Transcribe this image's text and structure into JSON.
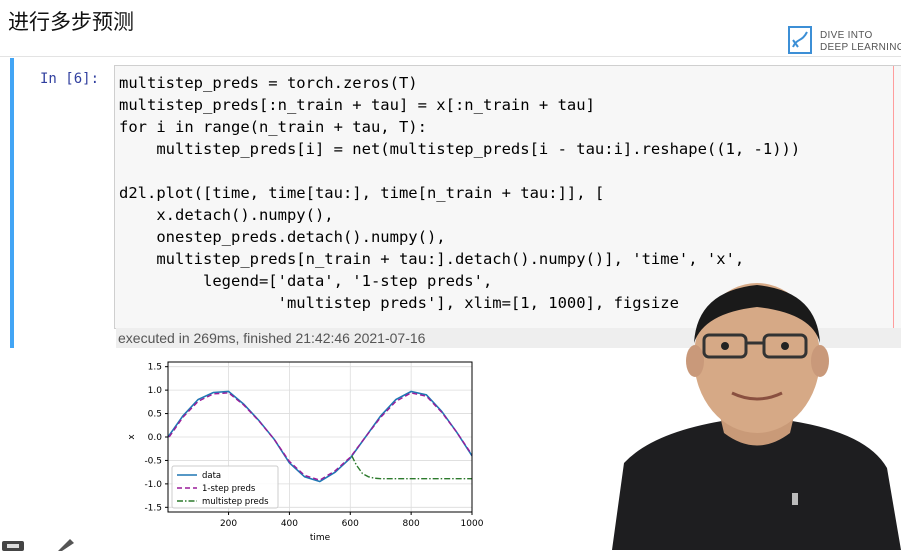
{
  "page": {
    "title": "进行多步预测",
    "logo_line1": "DIVE INTO",
    "logo_line2": "DEEP LEARNING"
  },
  "cell": {
    "prompt": "In [6]:",
    "code_lines": [
      "multistep_preds = torch.zeros(T)",
      "multistep_preds[:n_train + tau] = x[:n_train + tau]",
      "for i in range(n_train + tau, T):",
      "    multistep_preds[i] = net(multistep_preds[i - tau:i].reshape((1, -1)))",
      "",
      "d2l.plot([time, time[tau:], time[n_train + tau:]], [",
      "    x.detach().numpy(),",
      "    onestep_preds.detach().numpy(),",
      "    multistep_preds[n_train + tau:].detach().numpy()], 'time', 'x',",
      "         legend=['data', '1-step preds',",
      "                 'multistep preds'], xlim=[1, 1000], figsize"
    ],
    "executed": "executed in 269ms, finished 21:42:46 2021-07-16"
  },
  "chart_data": {
    "type": "line",
    "xlabel": "time",
    "ylabel": "x",
    "xlim": [
      1,
      1000
    ],
    "ylim": [
      -1.6,
      1.6
    ],
    "xticks": [
      200,
      400,
      600,
      800,
      1000
    ],
    "yticks": [
      1.5,
      1.0,
      0.5,
      0.0,
      -0.5,
      -1.0,
      -1.5
    ],
    "grid": true,
    "legend_position": "lower-left",
    "series": [
      {
        "name": "data",
        "color": "#1f77b4",
        "style": "solid",
        "x": [
          1,
          50,
          100,
          150,
          200,
          250,
          300,
          350,
          400,
          450,
          500,
          550,
          600,
          650,
          700,
          750,
          800,
          850,
          900,
          950,
          1000
        ],
        "y": [
          0.0,
          0.45,
          0.8,
          0.95,
          0.97,
          0.7,
          0.35,
          -0.05,
          -0.55,
          -0.85,
          -0.95,
          -0.75,
          -0.45,
          0.0,
          0.45,
          0.8,
          0.97,
          0.9,
          0.55,
          0.1,
          -0.4
        ]
      },
      {
        "name": "1-step preds",
        "color": "#9a1c9a",
        "style": "dashed",
        "x": [
          5,
          50,
          100,
          150,
          200,
          250,
          300,
          350,
          400,
          450,
          500,
          550,
          600,
          650,
          700,
          750,
          800,
          850,
          900,
          950,
          1000
        ],
        "y": [
          0.0,
          0.42,
          0.76,
          0.92,
          0.94,
          0.68,
          0.34,
          -0.05,
          -0.52,
          -0.82,
          -0.92,
          -0.72,
          -0.43,
          0.0,
          0.42,
          0.76,
          0.94,
          0.87,
          0.53,
          0.1,
          -0.38
        ]
      },
      {
        "name": "multistep preds",
        "color": "#2c7a2c",
        "style": "dashdot",
        "x": [
          605,
          620,
          640,
          660,
          680,
          700,
          750,
          800,
          850,
          900,
          950,
          1000
        ],
        "y": [
          -0.4,
          -0.6,
          -0.78,
          -0.85,
          -0.88,
          -0.89,
          -0.89,
          -0.89,
          -0.89,
          -0.89,
          -0.89,
          -0.89
        ]
      }
    ]
  },
  "colors": {
    "cell_bar": "#42a5f5",
    "prompt": "#303f9f",
    "keyword": "#008000",
    "string": "#ba2121"
  },
  "icons": [
    "dive-into-deep-learning-logo-icon",
    "edit-icon",
    "pencil-icon"
  ]
}
